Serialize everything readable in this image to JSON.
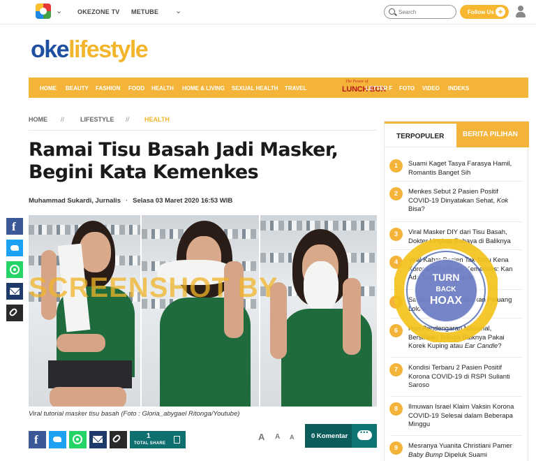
{
  "topbar": {
    "links": [
      "OKEZONE TV",
      "METUBE"
    ],
    "search_placeholder": "Search",
    "follow_label": "Follow Us",
    "follow_plus": "+"
  },
  "brand": {
    "oke": "oke",
    "life": "lifestyle"
  },
  "nav": {
    "items": [
      "HOME",
      "BEAUTY",
      "FASHION",
      "FOOD",
      "HEALTH",
      "HOME & LIVING",
      "SEXUAL HEALTH",
      "TRAVEL",
      "LETTER F",
      "FOTO",
      "VIDEO",
      "INDEKS"
    ],
    "lunchbox_tag": "The Power of",
    "lunchbox_label": "LUNCH BOX"
  },
  "breadcrumb": {
    "home": "HOME",
    "sep": "//",
    "section": "LIFESTYLE",
    "active": "HEALTH"
  },
  "article": {
    "title": "Ramai Tisu Basah Jadi Masker, Begini Kata Kemenkes",
    "author": "Muhammad Sukardi, Jurnalis",
    "dot": "·",
    "date": "Selasa 03 Maret 2020 16:53 WIB",
    "watermark": "SCREENSHOT BY",
    "caption": "Viral tutorial masker tisu basah (Foto : Gloria_abygael Ritonga/Youtube)"
  },
  "share": {
    "total_count": "1",
    "total_label": "TOTAL SHARE",
    "font_sizes": [
      "A",
      "A",
      "A"
    ],
    "komentar": "0 Komentar"
  },
  "sidebar": {
    "tab_popular": "TERPOPULER",
    "tab_pilihan": "BERITA PILIHAN",
    "items": [
      {
        "n": "1",
        "a": "Suami Kaget Tasya Farasya Hamil, Romantis Banget Sih",
        "i": "",
        "b": ""
      },
      {
        "n": "2",
        "a": "Menkes Sebut 2 Pasien Positif COVID-19 Dinyatakan Sehat, ",
        "i": "Kok",
        "b": " Bisa?"
      },
      {
        "n": "3",
        "a": "Viral Masker DIY dari Tisu Basah, Dokter Ungkap Bahaya di Baliknya",
        "i": "",
        "b": ""
      },
      {
        "n": "4",
        "a": "Viral Kabar Pasien Tak Tahu Kena Korona COVID-19, Kemenkes: Kan Ada Surat Persetujuan",
        "i": "",
        "b": ""
      },
      {
        "n": "5",
        "a": "Sagitarius Jangan Biarkan Peluang Lolos!",
        "i": "",
        "b": ""
      },
      {
        "n": "6",
        "a": "Hari Pendengaran Nasional, Bersihkan Telinga Baiknya Pakai Korek Kuping atau ",
        "i": "Ear Candle",
        "b": "?"
      },
      {
        "n": "7",
        "a": "Kondisi Terbaru 2 Pasien Positif Korona COVID-19 di RSPI Sulianti Saroso",
        "i": "",
        "b": ""
      },
      {
        "n": "8",
        "a": "Ilmuwan Israel Klaim Vaksin Korona COVID-19 Selesai dalam Beberapa Minggu",
        "i": "",
        "b": ""
      },
      {
        "n": "9",
        "a": "Mesranya Yuanita Christiani Pamer ",
        "i": "Baby Bump",
        "b": " Dipeluk Suami"
      }
    ]
  },
  "stamp": {
    "line1": "TURN",
    "line2": "BACK",
    "line3": "HOAX"
  },
  "colors": {
    "accent": "#f4b43a",
    "brand_blue": "#1e4fa0",
    "komentar": "#0c5c5c"
  }
}
